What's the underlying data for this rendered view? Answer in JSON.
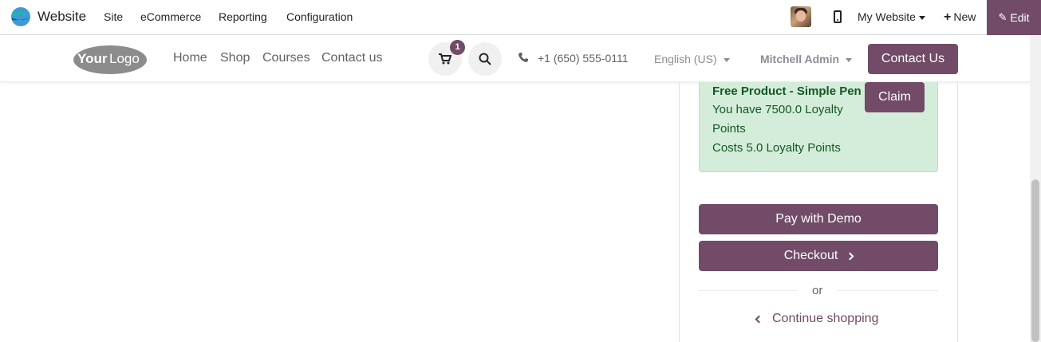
{
  "admin_bar": {
    "app_title": "Website",
    "menus": [
      "Site",
      "eCommerce",
      "Reporting",
      "Configuration"
    ],
    "my_website": "My Website",
    "new_label": "New",
    "edit_label": "Edit"
  },
  "header": {
    "logo_text": "YourLogo",
    "nav": [
      "Home",
      "Shop",
      "Courses",
      "Contact us"
    ],
    "cart_count": "1",
    "phone": "+1 (650) 555-0111",
    "language": "English (US)",
    "user": "Mitchell Admin",
    "contact_button": "Contact Us"
  },
  "reward": {
    "title": "Free Product - Simple Pen",
    "line1": "You have 7500.0 Loyalty",
    "line2": "Points",
    "line3": "Costs 5.0 Loyalty Points",
    "claim_label": "Claim"
  },
  "actions": {
    "pay_label": "Pay with Demo",
    "checkout_label": "Checkout",
    "or_label": "or",
    "continue_label": "Continue shopping"
  },
  "colors": {
    "brand": "#714b67",
    "success_bg": "#d4edda",
    "success_text": "#155724"
  }
}
